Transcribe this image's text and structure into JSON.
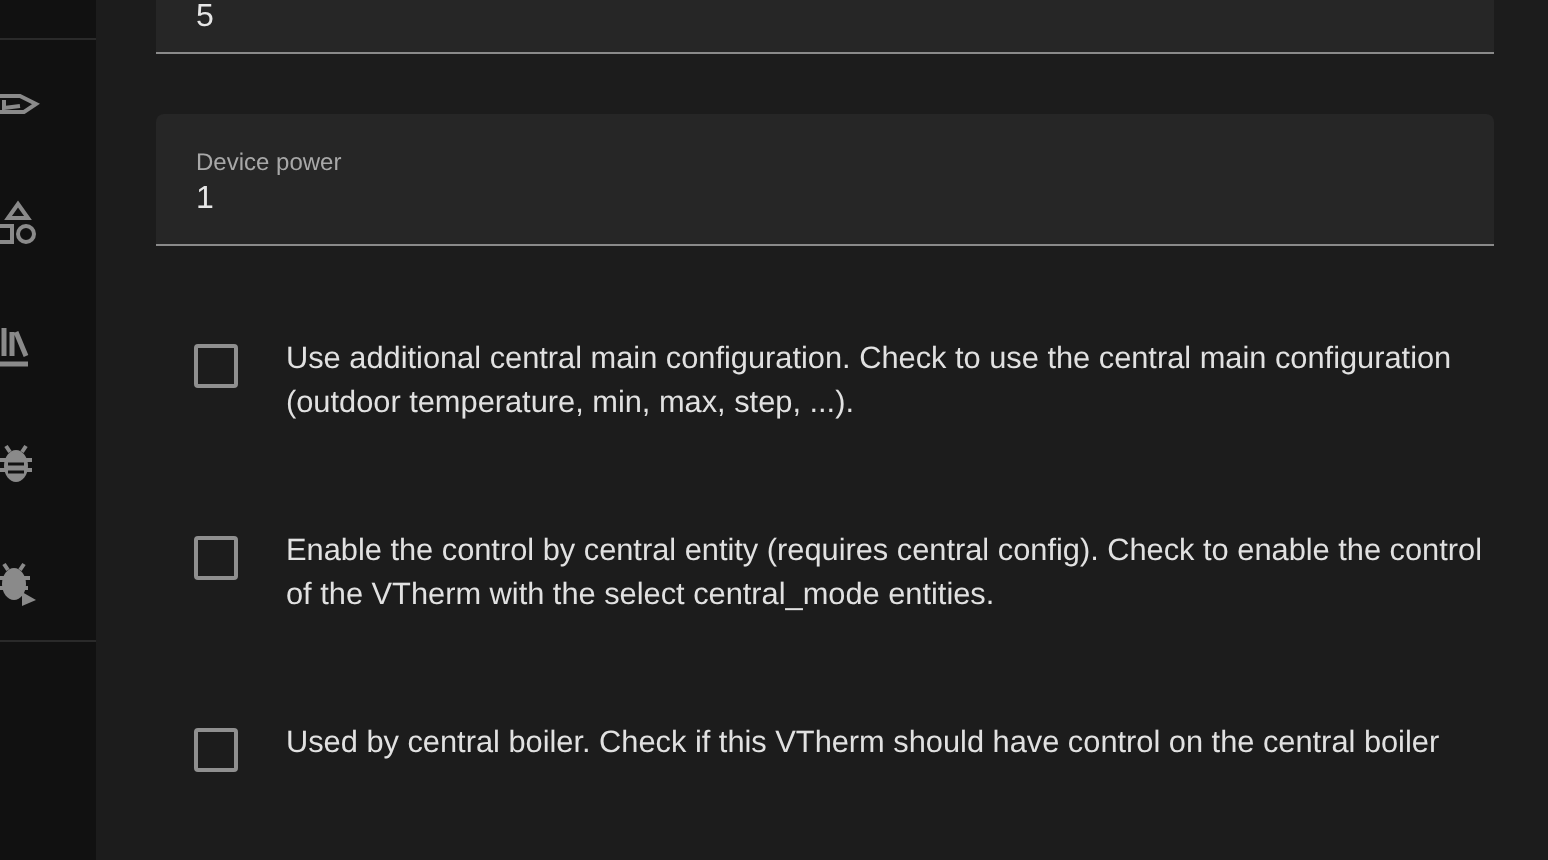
{
  "fields": [
    {
      "value": "5"
    },
    {
      "label": "Device power",
      "value": "1"
    }
  ],
  "options": [
    {
      "text": "Use additional central main configuration. Check to use the central main configuration (outdoor temperature, min, max, step, ...).",
      "checked": false
    },
    {
      "text": "Enable the control by central entity (requires central config). Check to enable the control of the VTherm with the select central_mode entities.",
      "checked": false
    },
    {
      "text": "Used by central boiler. Check if this VTherm should have control on the central boiler",
      "checked": false
    }
  ]
}
